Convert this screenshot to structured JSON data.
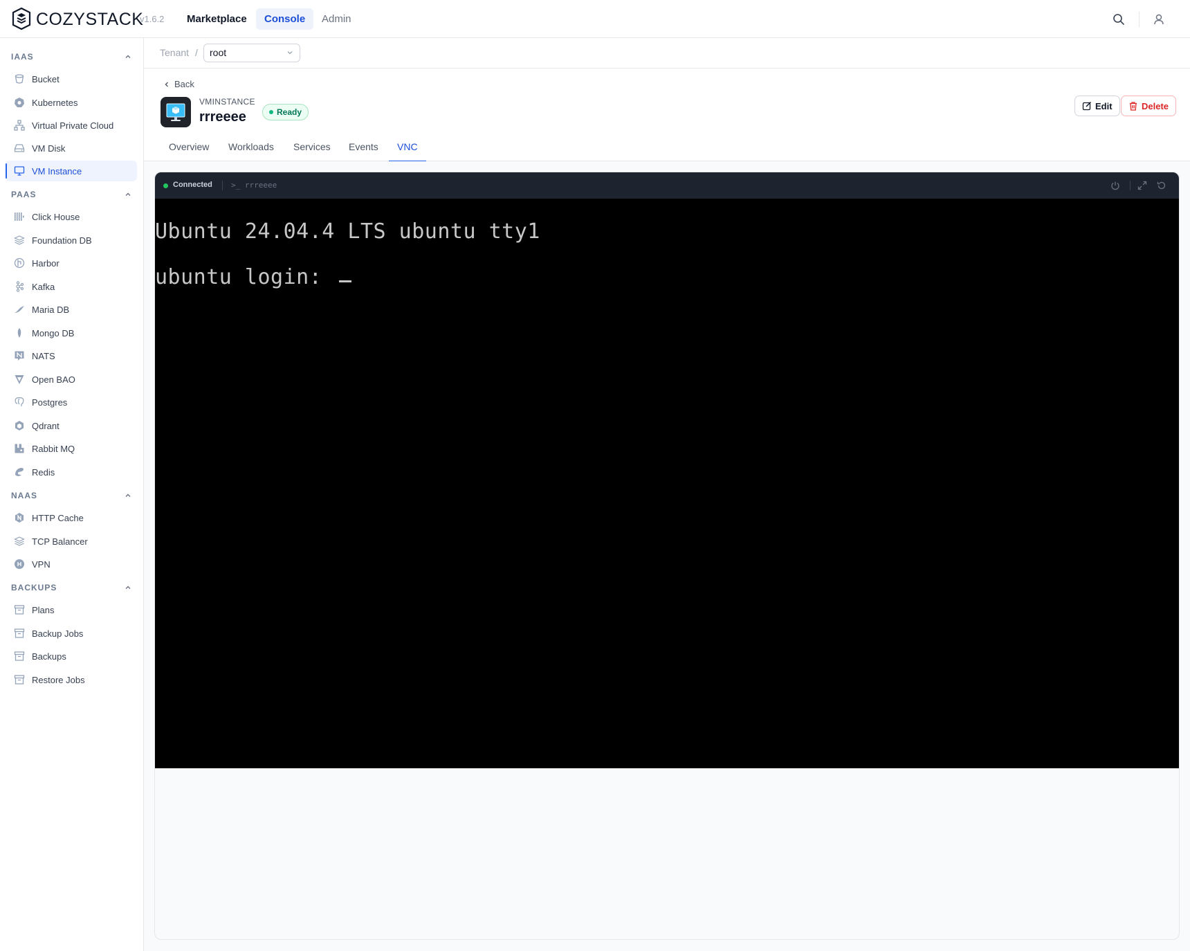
{
  "app": {
    "brand": "COZYSTACK",
    "version": "v1.6.2"
  },
  "nav": {
    "marketplace": "Marketplace",
    "console": "Console",
    "admin": "Admin"
  },
  "sidebar": {
    "sections": [
      {
        "title": "IAAS",
        "items": [
          "Bucket",
          "Kubernetes",
          "Virtual Private Cloud",
          "VM Disk",
          "VM Instance"
        ]
      },
      {
        "title": "PAAS",
        "items": [
          "Click House",
          "Foundation DB",
          "Harbor",
          "Kafka",
          "Maria DB",
          "Mongo DB",
          "NATS",
          "Open BAO",
          "Postgres",
          "Qdrant",
          "Rabbit MQ",
          "Redis"
        ]
      },
      {
        "title": "NAAS",
        "items": [
          "HTTP Cache",
          "TCP Balancer",
          "VPN"
        ]
      },
      {
        "title": "BACKUPS",
        "items": [
          "Plans",
          "Backup Jobs",
          "Backups",
          "Restore Jobs"
        ]
      }
    ],
    "active_item": "VM Instance"
  },
  "tenant": {
    "label": "Tenant",
    "separator": "/",
    "value": "root"
  },
  "resource": {
    "back_label": "Back",
    "kind": "VMINSTANCE",
    "name": "rrreeee",
    "status": "Ready",
    "edit_label": "Edit",
    "delete_label": "Delete"
  },
  "tabs": [
    "Overview",
    "Workloads",
    "Services",
    "Events",
    "VNC"
  ],
  "active_tab": "VNC",
  "vnc": {
    "status": "Connected",
    "terminal_name": "rrreeee",
    "lines": [
      "Ubuntu 24.04.4 LTS ubuntu tty1",
      "ubuntu login: "
    ]
  },
  "colors": {
    "accent": "#1d4ed8",
    "status_ready": "#10b981",
    "danger": "#dc2626"
  }
}
